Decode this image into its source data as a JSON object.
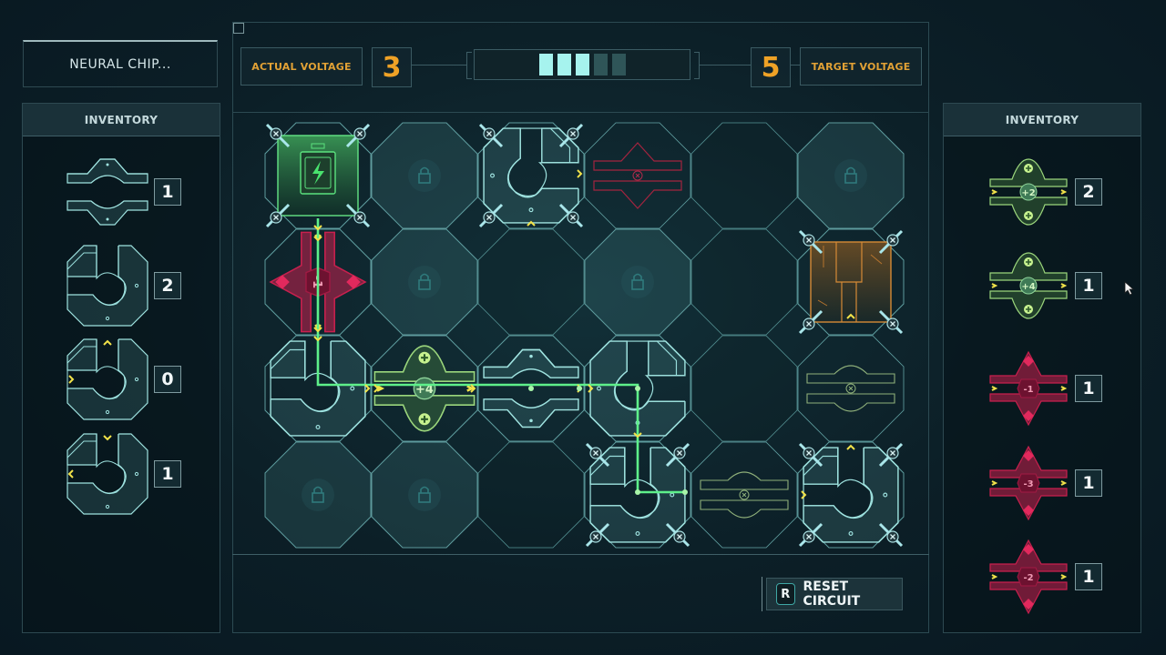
{
  "chip_title": "NEURAL CHIP...",
  "left_inventory": {
    "header": "INVENTORY",
    "items": [
      {
        "type": "horizontal-straight-tile",
        "count": "1"
      },
      {
        "type": "corner-tile-top-left",
        "count": "2"
      },
      {
        "type": "corner-tile-top-left-arrows",
        "count": "0"
      },
      {
        "type": "corner-tile-top-left-reversed",
        "count": "1"
      }
    ]
  },
  "right_inventory": {
    "header": "INVENTORY",
    "items": [
      {
        "type": "booster",
        "label": "+2",
        "count": "2",
        "color": "#9bd67c"
      },
      {
        "type": "booster",
        "label": "+4",
        "count": "1",
        "color": "#9bd67c"
      },
      {
        "type": "resistor",
        "label": "-1",
        "count": "1",
        "color": "#c8204e"
      },
      {
        "type": "resistor",
        "label": "-3",
        "count": "1",
        "color": "#c8204e"
      },
      {
        "type": "resistor",
        "label": "-2",
        "count": "1",
        "color": "#c8204e"
      }
    ]
  },
  "voltage": {
    "actual_label": "ACTUAL VOLTAGE",
    "actual_value": "3",
    "target_label": "TARGET VOLTAGE",
    "target_value": "5",
    "meter_segments_on": 3,
    "meter_segments_total": 5
  },
  "board": {
    "columns": 6,
    "rows": 4,
    "cells": [
      [
        "battery-source",
        "locked",
        "tile-placed-t",
        "resistor-ghost",
        "empty",
        "locked"
      ],
      [
        "resistor-placed-minus1",
        "locked",
        "empty",
        "locked",
        "empty",
        "output-node"
      ],
      [
        "tile-corner-powered",
        "booster-placed-plus4",
        "tile-straight-powered",
        "tile-corner-powered",
        "empty",
        "booster-ghost"
      ],
      [
        "locked",
        "locked",
        "empty",
        "tile-corner-powered",
        "booster-ghost",
        "tile-placed-t"
      ]
    ],
    "placed_labels": {
      "resistor": "-1",
      "booster": "+4"
    }
  },
  "reset": {
    "key": "R",
    "label": "RESET CIRCUIT"
  },
  "colors": {
    "accent_orange": "#efa226",
    "power_green": "#5ef08a",
    "resistor_red": "#c8204e",
    "tile_cyan": "#8fe3e0",
    "arrow_yellow": "#f2e34a"
  }
}
